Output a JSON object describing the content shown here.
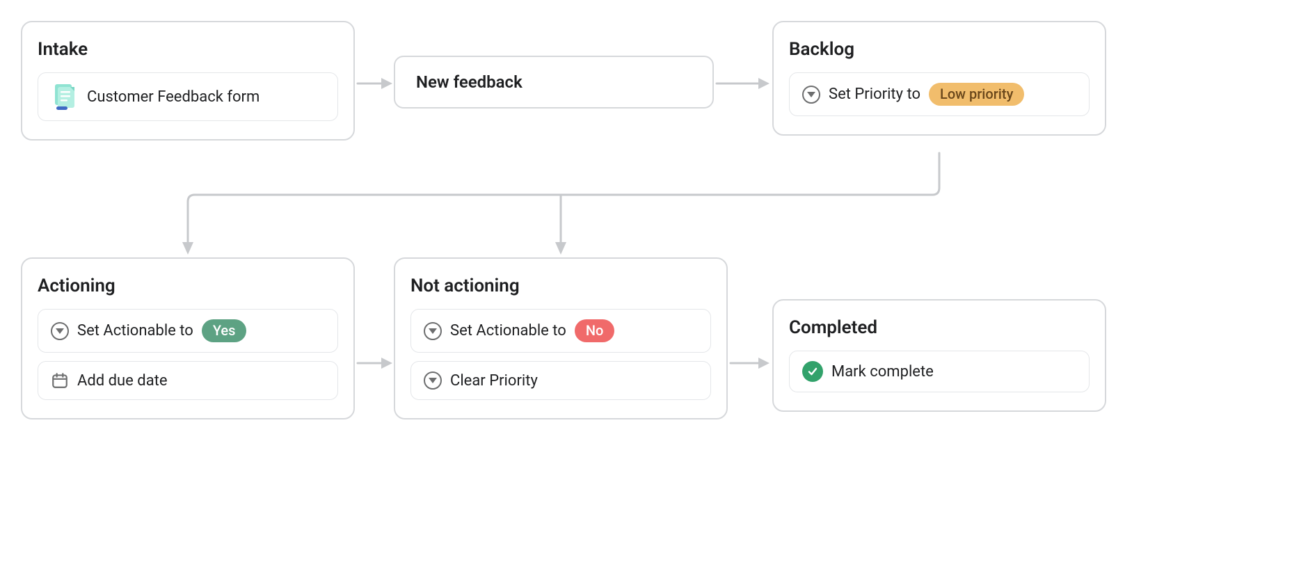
{
  "nodes": {
    "intake": {
      "title": "Intake",
      "rule_form": "Customer Feedback form"
    },
    "new_feedback": {
      "label": "New feedback"
    },
    "backlog": {
      "title": "Backlog",
      "rule_prefix": "Set Priority to",
      "pill": "Low priority"
    },
    "actioning": {
      "title": "Actioning",
      "rule1_prefix": "Set Actionable to",
      "rule1_pill": "Yes",
      "rule2": "Add due date"
    },
    "not_actioning": {
      "title": "Not actioning",
      "rule1_prefix": "Set Actionable to",
      "rule1_pill": "No",
      "rule2": "Clear Priority"
    },
    "completed": {
      "title": "Completed",
      "rule": "Mark complete"
    }
  },
  "colors": {
    "pill_orange": "#f1bd6c",
    "pill_green": "#5da283",
    "pill_red": "#f06a6a",
    "check_green": "#32a26b",
    "border": "#d6d8db",
    "connector": "#c7c9cc"
  }
}
